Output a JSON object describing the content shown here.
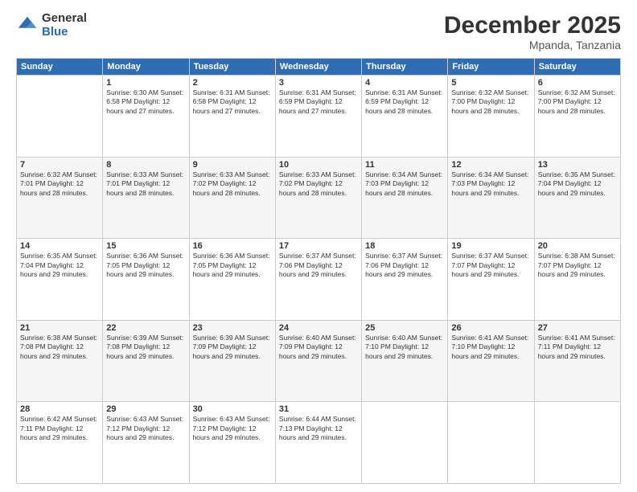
{
  "logo": {
    "general": "General",
    "blue": "Blue"
  },
  "header": {
    "month": "December 2025",
    "location": "Mpanda, Tanzania"
  },
  "weekdays": [
    "Sunday",
    "Monday",
    "Tuesday",
    "Wednesday",
    "Thursday",
    "Friday",
    "Saturday"
  ],
  "weeks": [
    [
      {
        "day": "",
        "info": ""
      },
      {
        "day": "1",
        "info": "Sunrise: 6:30 AM\nSunset: 6:58 PM\nDaylight: 12 hours\nand 27 minutes."
      },
      {
        "day": "2",
        "info": "Sunrise: 6:31 AM\nSunset: 6:58 PM\nDaylight: 12 hours\nand 27 minutes."
      },
      {
        "day": "3",
        "info": "Sunrise: 6:31 AM\nSunset: 6:59 PM\nDaylight: 12 hours\nand 27 minutes."
      },
      {
        "day": "4",
        "info": "Sunrise: 6:31 AM\nSunset: 6:59 PM\nDaylight: 12 hours\nand 28 minutes."
      },
      {
        "day": "5",
        "info": "Sunrise: 6:32 AM\nSunset: 7:00 PM\nDaylight: 12 hours\nand 28 minutes."
      },
      {
        "day": "6",
        "info": "Sunrise: 6:32 AM\nSunset: 7:00 PM\nDaylight: 12 hours\nand 28 minutes."
      }
    ],
    [
      {
        "day": "7",
        "info": "Sunrise: 6:32 AM\nSunset: 7:01 PM\nDaylight: 12 hours\nand 28 minutes."
      },
      {
        "day": "8",
        "info": "Sunrise: 6:33 AM\nSunset: 7:01 PM\nDaylight: 12 hours\nand 28 minutes."
      },
      {
        "day": "9",
        "info": "Sunrise: 6:33 AM\nSunset: 7:02 PM\nDaylight: 12 hours\nand 28 minutes."
      },
      {
        "day": "10",
        "info": "Sunrise: 6:33 AM\nSunset: 7:02 PM\nDaylight: 12 hours\nand 28 minutes."
      },
      {
        "day": "11",
        "info": "Sunrise: 6:34 AM\nSunset: 7:03 PM\nDaylight: 12 hours\nand 28 minutes."
      },
      {
        "day": "12",
        "info": "Sunrise: 6:34 AM\nSunset: 7:03 PM\nDaylight: 12 hours\nand 29 minutes."
      },
      {
        "day": "13",
        "info": "Sunrise: 6:35 AM\nSunset: 7:04 PM\nDaylight: 12 hours\nand 29 minutes."
      }
    ],
    [
      {
        "day": "14",
        "info": "Sunrise: 6:35 AM\nSunset: 7:04 PM\nDaylight: 12 hours\nand 29 minutes."
      },
      {
        "day": "15",
        "info": "Sunrise: 6:36 AM\nSunset: 7:05 PM\nDaylight: 12 hours\nand 29 minutes."
      },
      {
        "day": "16",
        "info": "Sunrise: 6:36 AM\nSunset: 7:05 PM\nDaylight: 12 hours\nand 29 minutes."
      },
      {
        "day": "17",
        "info": "Sunrise: 6:37 AM\nSunset: 7:06 PM\nDaylight: 12 hours\nand 29 minutes."
      },
      {
        "day": "18",
        "info": "Sunrise: 6:37 AM\nSunset: 7:06 PM\nDaylight: 12 hours\nand 29 minutes."
      },
      {
        "day": "19",
        "info": "Sunrise: 6:37 AM\nSunset: 7:07 PM\nDaylight: 12 hours\nand 29 minutes."
      },
      {
        "day": "20",
        "info": "Sunrise: 6:38 AM\nSunset: 7:07 PM\nDaylight: 12 hours\nand 29 minutes."
      }
    ],
    [
      {
        "day": "21",
        "info": "Sunrise: 6:38 AM\nSunset: 7:08 PM\nDaylight: 12 hours\nand 29 minutes."
      },
      {
        "day": "22",
        "info": "Sunrise: 6:39 AM\nSunset: 7:08 PM\nDaylight: 12 hours\nand 29 minutes."
      },
      {
        "day": "23",
        "info": "Sunrise: 6:39 AM\nSunset: 7:09 PM\nDaylight: 12 hours\nand 29 minutes."
      },
      {
        "day": "24",
        "info": "Sunrise: 6:40 AM\nSunset: 7:09 PM\nDaylight: 12 hours\nand 29 minutes."
      },
      {
        "day": "25",
        "info": "Sunrise: 6:40 AM\nSunset: 7:10 PM\nDaylight: 12 hours\nand 29 minutes."
      },
      {
        "day": "26",
        "info": "Sunrise: 6:41 AM\nSunset: 7:10 PM\nDaylight: 12 hours\nand 29 minutes."
      },
      {
        "day": "27",
        "info": "Sunrise: 6:41 AM\nSunset: 7:11 PM\nDaylight: 12 hours\nand 29 minutes."
      }
    ],
    [
      {
        "day": "28",
        "info": "Sunrise: 6:42 AM\nSunset: 7:11 PM\nDaylight: 12 hours\nand 29 minutes."
      },
      {
        "day": "29",
        "info": "Sunrise: 6:43 AM\nSunset: 7:12 PM\nDaylight: 12 hours\nand 29 minutes."
      },
      {
        "day": "30",
        "info": "Sunrise: 6:43 AM\nSunset: 7:12 PM\nDaylight: 12 hours\nand 29 minutes."
      },
      {
        "day": "31",
        "info": "Sunrise: 6:44 AM\nSunset: 7:13 PM\nDaylight: 12 hours\nand 29 minutes."
      },
      {
        "day": "",
        "info": ""
      },
      {
        "day": "",
        "info": ""
      },
      {
        "day": "",
        "info": ""
      }
    ]
  ]
}
